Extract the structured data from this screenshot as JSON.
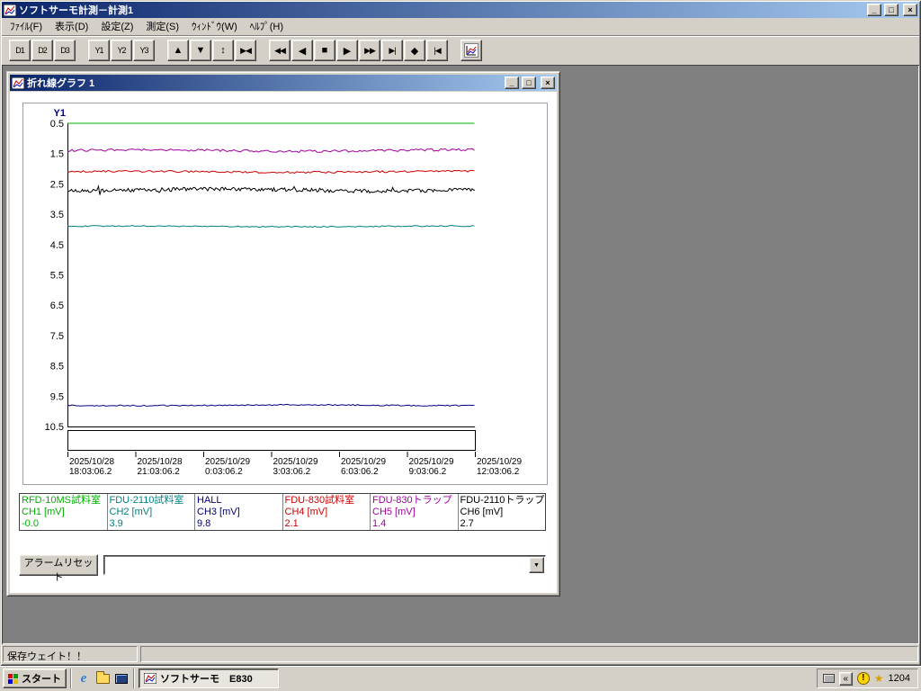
{
  "window": {
    "title": "ソフトサーモ計測－計測1",
    "minimize_label": "_",
    "restore_label": "□",
    "close_label": "×"
  },
  "menu": {
    "items": [
      {
        "name": "menu-file",
        "label": "ﾌｧｲﾙ(F)"
      },
      {
        "name": "menu-view",
        "label": "表示(D)"
      },
      {
        "name": "menu-settings",
        "label": "設定(Z)"
      },
      {
        "name": "menu-measure",
        "label": "測定(S)"
      },
      {
        "name": "menu-window",
        "label": "ｳｨﾝﾄﾞｳ(W)"
      },
      {
        "name": "menu-help",
        "label": "ﾍﾙﾌﾟ(H)"
      }
    ]
  },
  "toolbar": {
    "groups": [
      {
        "name": "display-group",
        "buttons": [
          {
            "name": "d1-button",
            "label": "D1"
          },
          {
            "name": "d2-button",
            "label": "D2"
          },
          {
            "name": "d3-button",
            "label": "D3"
          }
        ]
      },
      {
        "name": "yaxis-group",
        "buttons": [
          {
            "name": "y1-button",
            "label": "Y1"
          },
          {
            "name": "y2-button",
            "label": "Y2"
          },
          {
            "name": "y3-button",
            "label": "Y3"
          }
        ]
      },
      {
        "name": "scale-group",
        "buttons": [
          {
            "name": "scale-up-button",
            "label": "▲"
          },
          {
            "name": "scale-down-button",
            "label": "▼"
          },
          {
            "name": "scale-updown-button",
            "label": "↕"
          },
          {
            "name": "scale-fit-button",
            "label": "▶◀"
          }
        ]
      },
      {
        "name": "scroll-group",
        "buttons": [
          {
            "name": "fast-back-button",
            "label": "◀◀"
          },
          {
            "name": "back-button",
            "label": "◀"
          },
          {
            "name": "stop-button",
            "label": "■"
          },
          {
            "name": "forward-button",
            "label": "▶"
          },
          {
            "name": "fast-forward-button",
            "label": "▶▶"
          },
          {
            "name": "jump-end-button",
            "label": "▶|"
          },
          {
            "name": "center-button",
            "label": "◆"
          },
          {
            "name": "jump-home-button",
            "label": "|◀"
          }
        ]
      },
      {
        "name": "graph-group",
        "buttons": [
          {
            "name": "graph-window-button",
            "label": "",
            "icon": "graph"
          }
        ]
      }
    ]
  },
  "child_window": {
    "title": "折れ線グラフ 1",
    "minimize_label": "_",
    "maximize_label": "□",
    "close_label": "×",
    "alarm_reset_label": "アラームリセット",
    "combo_value": ""
  },
  "chart_data": {
    "type": "line",
    "y_axis_label": "Y1",
    "y_min": 0.5,
    "y_max": 10.5,
    "y_inverted": true,
    "grid": false,
    "y_ticks": [
      "0.5",
      "1.5",
      "2.5",
      "3.5",
      "4.5",
      "5.5",
      "6.5",
      "7.5",
      "8.5",
      "9.5",
      "10.5"
    ],
    "x_ticks": [
      {
        "date": "2025/10/28",
        "time": "18:03:06.2"
      },
      {
        "date": "2025/10/28",
        "time": "21:03:06.2"
      },
      {
        "date": "2025/10/29",
        "time": "0:03:06.2"
      },
      {
        "date": "2025/10/29",
        "time": "3:03:06.2"
      },
      {
        "date": "2025/10/29",
        "time": "6:03:06.2"
      },
      {
        "date": "2025/10/29",
        "time": "9:03:06.2"
      },
      {
        "date": "2025/10/29",
        "time": "12:03:06.2"
      }
    ],
    "series": [
      {
        "name": "RFD-10MS試料室",
        "channel": "CH1 [mV]",
        "value": -0.0,
        "display": "-0.0",
        "color": "#00b000",
        "noise": 0.0,
        "spiky": false
      },
      {
        "name": "FDU-2110試料室",
        "channel": "CH2 [mV]",
        "value": 3.9,
        "display": "3.9",
        "color": "#008080",
        "noise": 0.02,
        "spiky": false
      },
      {
        "name": "HALL",
        "channel": "CH3 [mV]",
        "value": 9.8,
        "display": "9.8",
        "color": "#000080",
        "noise": 0.02,
        "spiky": false
      },
      {
        "name": "FDU-830試料室",
        "channel": "CH4 [mV]",
        "value": 2.1,
        "display": "2.1",
        "color": "#cc0000",
        "noise": 0.03,
        "spiky": false
      },
      {
        "name": "FDU-830トラップ",
        "channel": "CH5 [mV]",
        "value": 1.4,
        "display": "1.4",
        "color": "#a000a0",
        "noise": 0.04,
        "spiky": false
      },
      {
        "name": "FDU-2110トラップ",
        "channel": "CH6 [mV]",
        "value": 2.7,
        "display": "2.7",
        "color": "#000000",
        "noise": 0.06,
        "spiky": true
      }
    ]
  },
  "status_bar": {
    "text": "保存ウェイト！！"
  },
  "taskbar": {
    "start_label": "スタート",
    "task_button_label": "ソフトサーモ　E830",
    "clock": "1204"
  }
}
